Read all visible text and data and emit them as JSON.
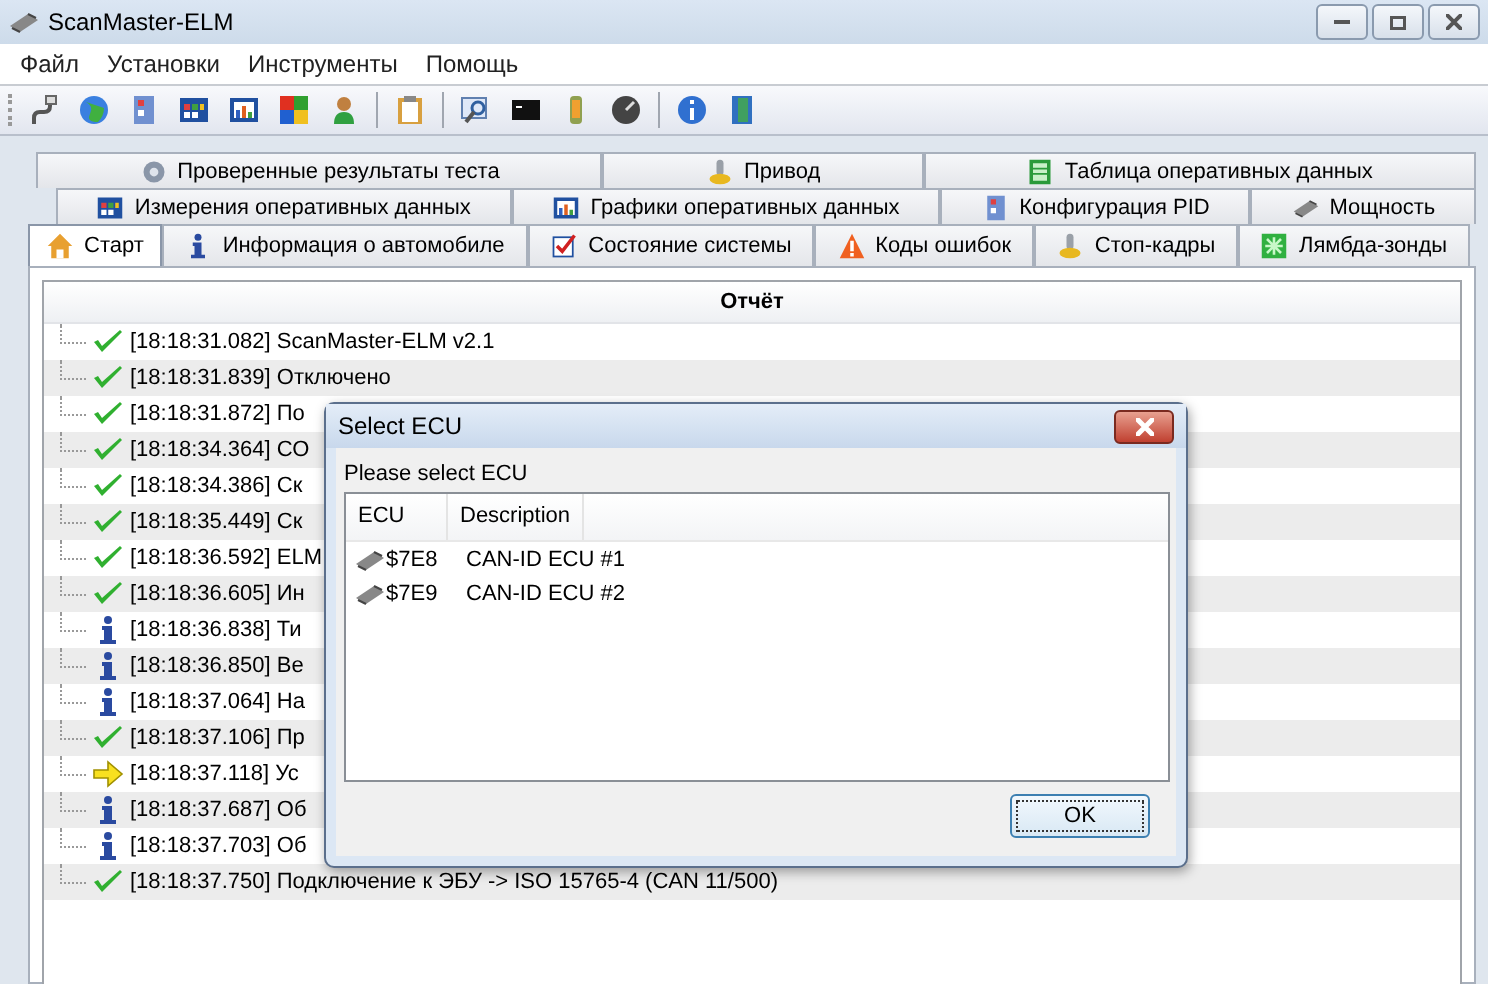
{
  "window": {
    "title": "ScanMaster-ELM"
  },
  "menu": [
    "Файл",
    "Установки",
    "Инструменты",
    "Помощь"
  ],
  "tab_rows": [
    [
      {
        "label": "Проверенные результаты теста",
        "kind": "gear",
        "selected": false
      },
      {
        "label": "Привод",
        "kind": "actuator",
        "selected": false
      },
      {
        "label": "Таблица оперативных данных",
        "kind": "table",
        "selected": false
      }
    ],
    [
      {
        "label": "Измерения оперативных данных",
        "kind": "grid",
        "selected": false
      },
      {
        "label": "Графики оперативных данных",
        "kind": "chart",
        "selected": false
      },
      {
        "label": "Конфигурация PID",
        "kind": "doc",
        "selected": false
      },
      {
        "label": "Мощность",
        "kind": "chip",
        "selected": false
      }
    ],
    [
      {
        "label": "Старт",
        "kind": "house",
        "selected": true
      },
      {
        "label": "Информация о автомобиле",
        "kind": "info",
        "selected": false
      },
      {
        "label": "Состояние системы",
        "kind": "checkbox",
        "selected": false
      },
      {
        "label": "Коды ошибок",
        "kind": "warning",
        "selected": false
      },
      {
        "label": "Стоп-кадры",
        "kind": "actuator",
        "selected": false
      },
      {
        "label": "Лямбда-зонды",
        "kind": "sensor",
        "selected": false
      }
    ]
  ],
  "report": {
    "header": "Отчёт",
    "rows": [
      {
        "kind": "ok",
        "text": "[18:18:31.082] ScanMaster-ELM v2.1"
      },
      {
        "kind": "ok",
        "text": "[18:18:31.839] Отключено"
      },
      {
        "kind": "ok",
        "text": "[18:18:31.872] По"
      },
      {
        "kind": "ok",
        "text": "[18:18:34.364] СО"
      },
      {
        "kind": "ok",
        "text": "[18:18:34.386] Ск"
      },
      {
        "kind": "ok",
        "text": "[18:18:35.449] Ск"
      },
      {
        "kind": "ok",
        "text": "[18:18:36.592] ELM"
      },
      {
        "kind": "ok",
        "text": "[18:18:36.605] Ин"
      },
      {
        "kind": "info",
        "text": "[18:18:36.838] Ти"
      },
      {
        "kind": "info",
        "text": "[18:18:36.850] Ве"
      },
      {
        "kind": "info",
        "text": "[18:18:37.064] На"
      },
      {
        "kind": "ok",
        "text": "[18:18:37.106] Пр"
      },
      {
        "kind": "arrow",
        "text": "[18:18:37.118] Ус"
      },
      {
        "kind": "info",
        "text": "[18:18:37.687] Об"
      },
      {
        "kind": "info",
        "text": "[18:18:37.703] Об"
      },
      {
        "kind": "ok",
        "text": "[18:18:37.750] Подключение к ЭБУ -> ISO 15765-4 (CAN 11/500)"
      }
    ]
  },
  "dialog": {
    "title": "Select ECU",
    "prompt": "Please select ECU",
    "columns": [
      "ECU",
      "Description"
    ],
    "rows": [
      {
        "ecu": "$7E8",
        "description": "CAN-ID ECU #1"
      },
      {
        "ecu": "$7E9",
        "description": "CAN-ID ECU #2"
      }
    ],
    "button": "OK"
  }
}
